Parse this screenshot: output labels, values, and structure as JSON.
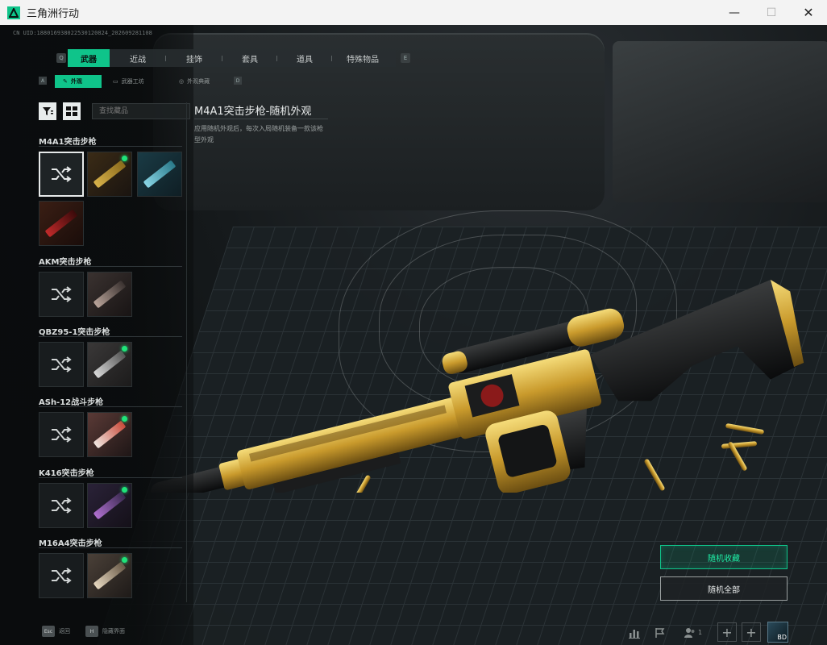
{
  "window": {
    "title": "三角洲行动",
    "minimize": "—",
    "maximize": "☐",
    "close": "✕"
  },
  "uid_text": "CN UID:1880169380225301208​24_202609281108",
  "main_tabs": {
    "left_key": "Q",
    "right_key": "E",
    "items": [
      {
        "label": "武器"
      },
      {
        "label": "近战"
      },
      {
        "label": "挂饰"
      },
      {
        "label": "套具"
      },
      {
        "label": "道具"
      },
      {
        "label": "特殊物品"
      }
    ]
  },
  "sub_tabs": {
    "left_key": "A",
    "right_key": "D",
    "items": [
      {
        "label": "外观",
        "icon": "brush-icon"
      },
      {
        "label": "武器工坊",
        "icon": "workshop-icon"
      },
      {
        "label": "外观典藏",
        "icon": "collection-icon"
      }
    ]
  },
  "search": {
    "placeholder": "查找藏品"
  },
  "selected_item": {
    "title": "M4A1突击步枪-随机外观",
    "description": "应用随机外观后，每次入局随机装备一款该枪型外观"
  },
  "categories": [
    {
      "name": "M4A1突击步枪"
    },
    {
      "name": "AKM突击步枪"
    },
    {
      "name": "QBZ95-1突击步枪"
    },
    {
      "name": "ASh-12战斗步枪"
    },
    {
      "name": "K416突击步枪"
    },
    {
      "name": "M16A4突击步枪"
    }
  ],
  "buttons": {
    "random_favorites": "随机收藏",
    "random_all": "随机全部"
  },
  "bottom_hints": [
    {
      "key": "Esc",
      "label": "返回"
    },
    {
      "key": "H",
      "label": "隐藏界面"
    }
  ],
  "friends_count": "1",
  "avatar_badge": "BD",
  "colors": {
    "accent": "#0fc48a",
    "new_dot": "#1fe37a"
  }
}
